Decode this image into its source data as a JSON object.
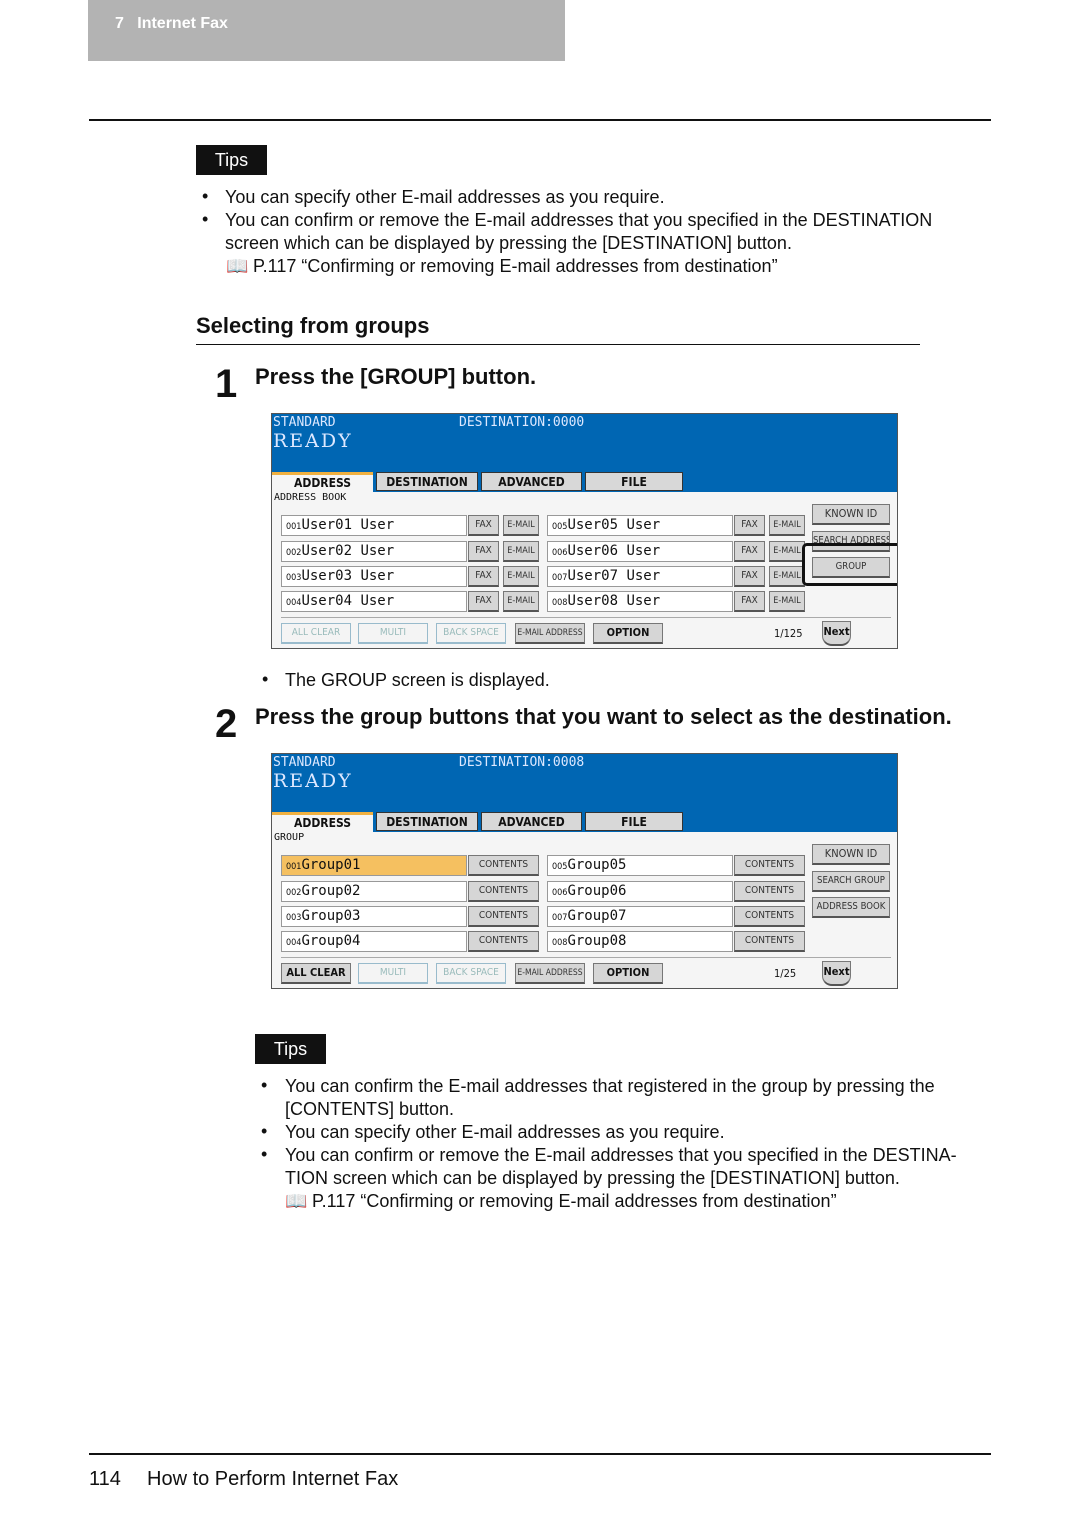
{
  "header": {
    "chapter_number": "7",
    "chapter_title": "Internet Fax"
  },
  "tips1": {
    "label": "Tips",
    "items": [
      "You can specify other E-mail addresses as you require.",
      "You can confirm or remove the E-mail addresses that you specified in the DESTINATION",
      "screen which can be displayed by pressing the [DESTINATION] button."
    ],
    "ref": "P.117 “Confirming or removing E-mail addresses from destination”"
  },
  "section_title": "Selecting from groups",
  "step1": {
    "number": "1",
    "title": "Press the [GROUP] button.",
    "note": "The GROUP screen is displayed."
  },
  "step2": {
    "number": "2",
    "title": "Press the group buttons that you want to select as the destination."
  },
  "screens": [
    {
      "mode": "STANDARD",
      "destination": "DESTINATION:0000",
      "status": "READY",
      "tabs": [
        "ADDRESS",
        "DESTINATION",
        "ADVANCED",
        "FILE"
      ],
      "sublabel": "ADDRESS BOOK",
      "entries": [
        {
          "no": "001",
          "name": "User01 User"
        },
        {
          "no": "002",
          "name": "User02 User"
        },
        {
          "no": "003",
          "name": "User03 User"
        },
        {
          "no": "004",
          "name": "User04 User"
        },
        {
          "no": "005",
          "name": "User05 User"
        },
        {
          "no": "006",
          "name": "User06 User"
        },
        {
          "no": "007",
          "name": "User07 User"
        },
        {
          "no": "008",
          "name": "User08 User"
        }
      ],
      "entry_buttons": [
        "FAX",
        "E-MAIL"
      ],
      "side_buttons": [
        "KNOWN ID",
        "SEARCH ADDRESS",
        "GROUP"
      ],
      "highlighted_side": "GROUP",
      "bottom_buttons": [
        "ALL CLEAR",
        "MULTI",
        "BACK SPACE",
        "E-MAIL ADDRESS",
        "OPTION"
      ],
      "bottom_disabled": [
        true,
        true,
        true,
        false,
        false
      ],
      "page": "1/125",
      "next": "Next"
    },
    {
      "mode": "STANDARD",
      "destination": "DESTINATION:0008",
      "status": "READY",
      "tabs": [
        "ADDRESS",
        "DESTINATION",
        "ADVANCED",
        "FILE"
      ],
      "sublabel": "GROUP",
      "entries": [
        {
          "no": "001",
          "name": "Group01",
          "selected": true
        },
        {
          "no": "002",
          "name": "Group02"
        },
        {
          "no": "003",
          "name": "Group03"
        },
        {
          "no": "004",
          "name": "Group04"
        },
        {
          "no": "005",
          "name": "Group05"
        },
        {
          "no": "006",
          "name": "Group06"
        },
        {
          "no": "007",
          "name": "Group07"
        },
        {
          "no": "008",
          "name": "Group08"
        }
      ],
      "entry_buttons": [
        "CONTENTS"
      ],
      "side_buttons": [
        "KNOWN ID",
        "SEARCH GROUP",
        "ADDRESS BOOK"
      ],
      "bottom_buttons": [
        "ALL CLEAR",
        "MULTI",
        "BACK SPACE",
        "E-MAIL ADDRESS",
        "OPTION"
      ],
      "bottom_disabled": [
        false,
        true,
        true,
        false,
        false
      ],
      "page": "1/25",
      "next": "Next"
    }
  ],
  "tips2": {
    "label": "Tips",
    "items": [
      "You can confirm the E-mail addresses that registered in the group by pressing the",
      "[CONTENTS] button.",
      "You can specify other E-mail addresses as you require.",
      "You can confirm or remove the E-mail addresses that you specified in the DESTINA-",
      "TION screen which can be displayed by pressing the [DESTINATION] button."
    ],
    "ref": "P.117 “Confirming or removing E-mail addresses from destination”"
  },
  "footer": {
    "page_number": "114",
    "title": "How to Perform Internet Fax"
  },
  "colors": {
    "screen_header": "#0066b3",
    "selected_entry": "#f5c060",
    "chapter_bar": "#b3b3b3"
  }
}
